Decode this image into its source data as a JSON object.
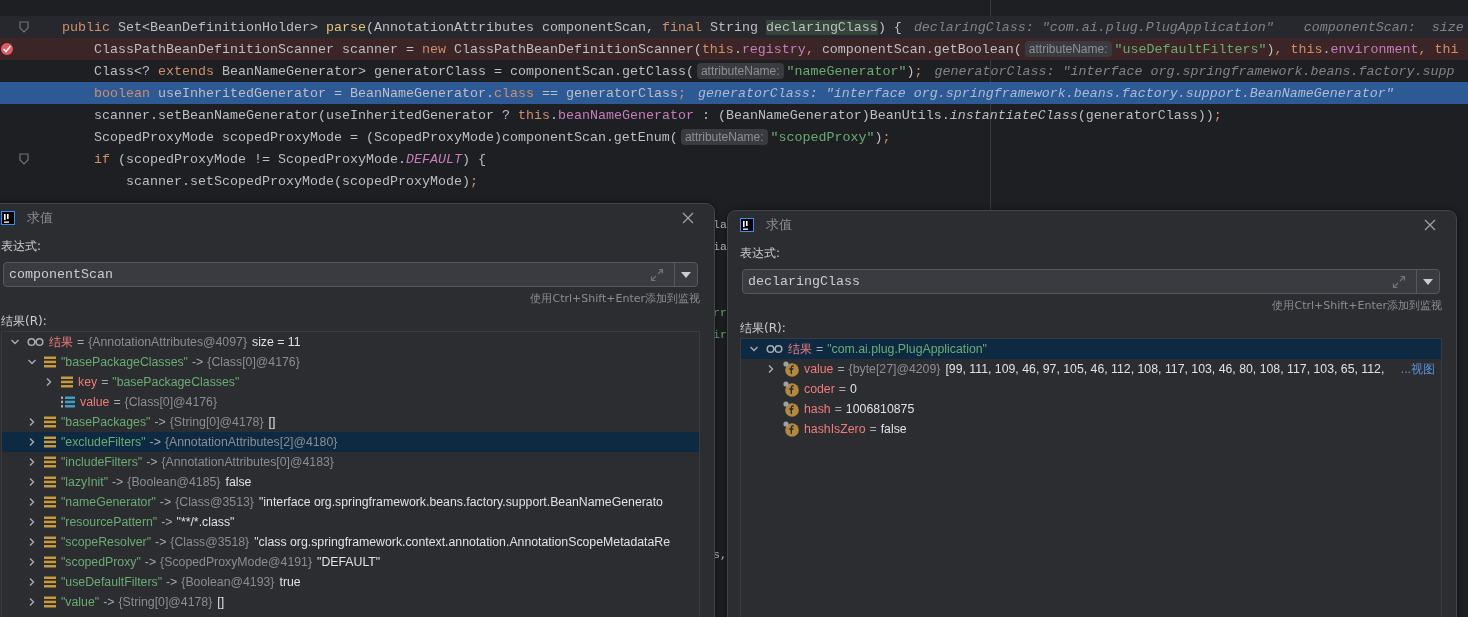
{
  "editor": {
    "lines": [
      {
        "kind": "current",
        "foldable": true,
        "parts": [
          {
            "kind": "code",
            "tokens": [
              {
                "t": "public ",
                "kind": "kw"
              },
              {
                "t": "Set<BeanDefinitionHolder> ",
                "kind": "plain"
              },
              {
                "t": "parse",
                "kind": "fn"
              },
              {
                "t": "(AnnotationAttributes componentScan, ",
                "kind": "plain"
              },
              {
                "t": "final ",
                "kind": "kw"
              },
              {
                "t": "String ",
                "kind": "plain"
              },
              {
                "t": "declaringClass",
                "kind": "match"
              },
              {
                "t": ") {",
                "kind": "plain"
              }
            ]
          },
          {
            "kind": "hint",
            "text": "declaringClass: \"com.ai.plug.PlugApplication\""
          },
          {
            "kind": "hint",
            "text": "componentScan:  size"
          }
        ]
      },
      {
        "kind": "breakpoint",
        "foldable": false,
        "parts": [
          {
            "kind": "code",
            "tokens": [
              {
                "t": "    ClassPathBeanDefinitionScanner scanner = ",
                "kind": "plain"
              },
              {
                "t": "new ",
                "kind": "kw"
              },
              {
                "t": "ClassPathBeanDefinitionScanner(",
                "kind": "plain"
              },
              {
                "t": "this",
                "kind": "kw"
              },
              {
                "t": ".",
                "kind": "plain"
              },
              {
                "t": "registry",
                "kind": "field"
              },
              {
                "t": ", ",
                "kind": "kw"
              },
              {
                "t": "componentScan.getBoolean(",
                "kind": "plain"
              }
            ]
          },
          {
            "kind": "chip",
            "text": "attributeName:"
          },
          {
            "kind": "code",
            "tokens": [
              {
                "t": "\"useDefaultFilters\"",
                "kind": "str"
              },
              {
                "t": ")",
                "kind": "plain"
              },
              {
                "t": ", ",
                "kind": "kw"
              },
              {
                "t": "this",
                "kind": "kw"
              },
              {
                "t": ".",
                "kind": "plain"
              },
              {
                "t": "environment",
                "kind": "field"
              },
              {
                "t": ", ",
                "kind": "kw"
              },
              {
                "t": "thi",
                "kind": "kw"
              }
            ]
          }
        ]
      },
      {
        "kind": "normal",
        "foldable": false,
        "parts": [
          {
            "kind": "code",
            "tokens": [
              {
                "t": "    Class<? ",
                "kind": "plain"
              },
              {
                "t": "extends ",
                "kind": "kw"
              },
              {
                "t": "BeanNameGenerator> generatorClass = componentScan.getClass(",
                "kind": "plain"
              }
            ]
          },
          {
            "kind": "chip",
            "text": "attributeName:"
          },
          {
            "kind": "code",
            "tokens": [
              {
                "t": "\"nameGenerator\"",
                "kind": "str"
              },
              {
                "t": ")",
                "kind": "plain"
              },
              {
                "t": ";",
                "kind": "kw"
              }
            ]
          },
          {
            "kind": "hint",
            "text": "generatorClass: \"interface org.springframework.beans.factory.supp"
          }
        ]
      },
      {
        "kind": "selected",
        "foldable": false,
        "parts": [
          {
            "kind": "code",
            "tokens": [
              {
                "t": "    boolean ",
                "kind": "kw"
              },
              {
                "t": "useInheritedGenerator = BeanNameGenerator.",
                "kind": "plain"
              },
              {
                "t": "class",
                "kind": "kw"
              },
              {
                "t": " == generatorClass",
                "kind": "plain"
              },
              {
                "t": ";",
                "kind": "kw"
              }
            ]
          },
          {
            "kind": "hint",
            "text": "generatorClass: \"interface org.springframework.beans.factory.support.BeanNameGenerator\""
          }
        ]
      },
      {
        "kind": "normal",
        "foldable": false,
        "parts": [
          {
            "kind": "code",
            "tokens": [
              {
                "t": "    scanner.setBeanNameGenerator(useInheritedGenerator ? ",
                "kind": "plain"
              },
              {
                "t": "this",
                "kind": "kw"
              },
              {
                "t": ".",
                "kind": "plain"
              },
              {
                "t": "beanNameGenerator",
                "kind": "field"
              },
              {
                "t": " : (BeanNameGenerator)BeanUtils.",
                "kind": "plain"
              },
              {
                "t": "instantiateClass",
                "kind": "italic"
              },
              {
                "t": "(generatorClass))",
                "kind": "plain"
              },
              {
                "t": ";",
                "kind": "kw"
              }
            ]
          }
        ]
      },
      {
        "kind": "normal",
        "foldable": false,
        "parts": [
          {
            "kind": "code",
            "tokens": [
              {
                "t": "    ScopedProxyMode scopedProxyMode = (ScopedProxyMode)componentScan.getEnum(",
                "kind": "plain"
              }
            ]
          },
          {
            "kind": "chip",
            "text": "attributeName:"
          },
          {
            "kind": "code",
            "tokens": [
              {
                "t": "\"scopedProxy\"",
                "kind": "str"
              },
              {
                "t": ")",
                "kind": "plain"
              },
              {
                "t": ";",
                "kind": "kw"
              }
            ]
          }
        ]
      },
      {
        "kind": "normal",
        "foldable": true,
        "parts": [
          {
            "kind": "code",
            "tokens": [
              {
                "t": "    if ",
                "kind": "kw"
              },
              {
                "t": "(scopedProxyMode != ScopedProxyMode.",
                "kind": "plain"
              },
              {
                "t": "DEFAULT",
                "kind": "static"
              },
              {
                "t": ") {",
                "kind": "plain"
              }
            ]
          }
        ]
      },
      {
        "kind": "normal",
        "foldable": false,
        "parts": [
          {
            "kind": "code",
            "tokens": [
              {
                "t": "        scanner.setScopedProxyMode(scopedProxyMode)",
                "kind": "plain"
              },
              {
                "t": ";",
                "kind": "kw"
              }
            ]
          }
        ]
      }
    ],
    "fragments": [
      {
        "text": "la",
        "kind": "plain"
      },
      {
        "text": "ia",
        "kind": "plain"
      },
      {
        "text": "rr",
        "kind": "str"
      },
      {
        "text": "ir",
        "kind": "str"
      },
      {
        "text": "s,",
        "kind": "plain"
      }
    ]
  },
  "dialogs": [
    {
      "title": "求值",
      "expression_label": "表达式:",
      "expression": "componentScan",
      "hint": "使用Ctrl+Shift+Enter添加到监视",
      "result_label": "结果(R):",
      "tree": [
        {
          "kind": "watch",
          "name": "结果",
          "sep": "=",
          "ref": "{AnnotationAttributes@4097}",
          "value": "size = 11",
          "expanded": true,
          "selected": false,
          "children": [
            {
              "kind": "entry",
              "name": "\"basePackageClasses\"",
              "sep": "->",
              "ref": "{Class[0]@4176}",
              "expanded": true,
              "selected": false,
              "children": [
                {
                  "kind": "field",
                  "name": "key",
                  "sep": "=",
                  "string_value": "\"basePackageClasses\"",
                  "expanded": false,
                  "selected": false
                },
                {
                  "kind": "array",
                  "name": "value",
                  "sep": "=",
                  "ref": "{Class[0]@4176}",
                  "selected": false
                }
              ]
            },
            {
              "kind": "entry",
              "name": "\"basePackages\"",
              "sep": "->",
              "ref": "{String[0]@4178}",
              "value": "[]",
              "expanded": false,
              "selected": false
            },
            {
              "kind": "entry",
              "name": "\"excludeFilters\"",
              "sep": "->",
              "ref": "{AnnotationAttributes[2]@4180}",
              "expanded": false,
              "selected": true
            },
            {
              "kind": "entry",
              "name": "\"includeFilters\"",
              "sep": "->",
              "ref": "{AnnotationAttributes[0]@4183}",
              "expanded": false,
              "selected": false
            },
            {
              "kind": "entry",
              "name": "\"lazyInit\"",
              "sep": "->",
              "ref": "{Boolean@4185}",
              "value": "false",
              "expanded": false,
              "selected": false
            },
            {
              "kind": "entry",
              "name": "\"nameGenerator\"",
              "sep": "->",
              "ref": "{Class@3513}",
              "value": "\"interface org.springframework.beans.factory.support.BeanNameGenerato",
              "expanded": false,
              "selected": false
            },
            {
              "kind": "entry",
              "name": "\"resourcePattern\"",
              "sep": "->",
              "value": "\"**/*.class\"",
              "expanded": false,
              "selected": false
            },
            {
              "kind": "entry",
              "name": "\"scopeResolver\"",
              "sep": "->",
              "ref": "{Class@3518}",
              "value": "\"class org.springframework.context.annotation.AnnotationScopeMetadataRe",
              "expanded": false,
              "selected": false
            },
            {
              "kind": "entry",
              "name": "\"scopedProxy\"",
              "sep": "->",
              "ref": "{ScopedProxyMode@4191}",
              "value": "\"DEFAULT\"",
              "expanded": false,
              "selected": false
            },
            {
              "kind": "entry",
              "name": "\"useDefaultFilters\"",
              "sep": "->",
              "ref": "{Boolean@4193}",
              "value": "true",
              "expanded": false,
              "selected": false
            },
            {
              "kind": "entry",
              "name": "\"value\"",
              "sep": "->",
              "ref": "{String[0]@4178}",
              "value": "[]",
              "expanded": false,
              "selected": false
            }
          ]
        }
      ]
    },
    {
      "title": "求值",
      "expression_label": "表达式:",
      "expression": "declaringClass",
      "hint": "使用Ctrl+Shift+Enter添加到监视",
      "result_label": "结果(R):",
      "tree": [
        {
          "kind": "watch",
          "name": "结果",
          "sep": "=",
          "string_value": "\"com.ai.plug.PlugApplication\"",
          "expanded": true,
          "selected": true,
          "children": [
            {
              "kind": "field",
              "name": "value",
              "sep": "=",
              "ref": "{byte[27]@4209}",
              "value": "[99, 111, 109, 46, 97, 105, 46, 112, 108, 117, 103, 46, 80, 108, 117, 103, 65, 112,",
              "link": "...视图",
              "expanded": false,
              "selected": false
            },
            {
              "kind": "field",
              "name": "coder",
              "sep": "=",
              "value": "0",
              "selected": false
            },
            {
              "kind": "field",
              "name": "hash",
              "sep": "=",
              "value": "1006810875",
              "selected": false
            },
            {
              "kind": "field",
              "name": "hashIsZero",
              "sep": "=",
              "value": "false",
              "selected": false
            }
          ]
        }
      ]
    }
  ]
}
